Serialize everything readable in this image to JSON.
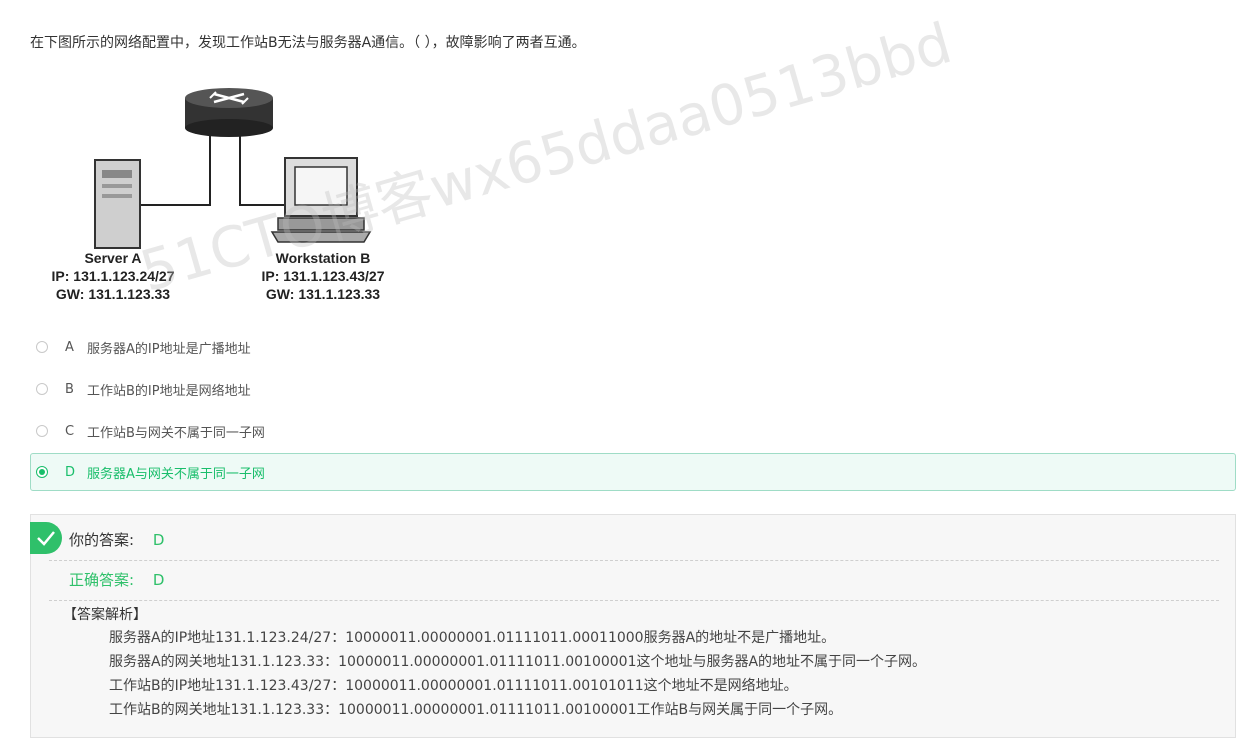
{
  "question": {
    "text": "在下图所示的网络配置中，发现工作站B无法与服务器A通信。（ ），故障影响了两者互通。"
  },
  "figure": {
    "server": {
      "name": "Server A",
      "ip": "IP: 131.1.123.24/27",
      "gw": "GW: 131.1.123.33"
    },
    "workstation": {
      "name": "Workstation B",
      "ip": "IP: 131.1.123.43/27",
      "gw": "GW: 131.1.123.33"
    },
    "watermark": "51CTO博客wx65ddaa0513bbd"
  },
  "options": [
    {
      "letter": "A",
      "text": "服务器A的IP地址是广播地址",
      "selected": false
    },
    {
      "letter": "B",
      "text": "工作站B的IP地址是网络地址",
      "selected": false
    },
    {
      "letter": "C",
      "text": "工作站B与网关不属于同一子网",
      "selected": false
    },
    {
      "letter": "D",
      "text": "服务器A与网关不属于同一子网",
      "selected": true
    }
  ],
  "result": {
    "your_answer_label": "你的答案:",
    "your_answer_value": "D",
    "correct_answer_label": "正确答案:",
    "correct_answer_value": "D",
    "analysis_title": "【答案解析】",
    "analysis_lines": [
      "服务器A的IP地址131.1.123.24/27：10000011.00000001.01111011.00011000服务器A的地址不是广播地址。",
      "服务器A的网关地址131.1.123.33：10000011.00000001.01111011.00100001这个地址与服务器A的地址不属于同一个子网。",
      "工作站B的IP地址131.1.123.43/27：10000011.00000001.01111011.00101011这个地址不是网络地址。",
      "工作站B的网关地址131.1.123.33：10000011.00000001.01111011.00100001工作站B与网关属于同一个子网。"
    ]
  },
  "colors": {
    "accent_green": "#2fc06a",
    "selected_bg": "#eefaf6",
    "selected_border": "#9fdcc6"
  }
}
